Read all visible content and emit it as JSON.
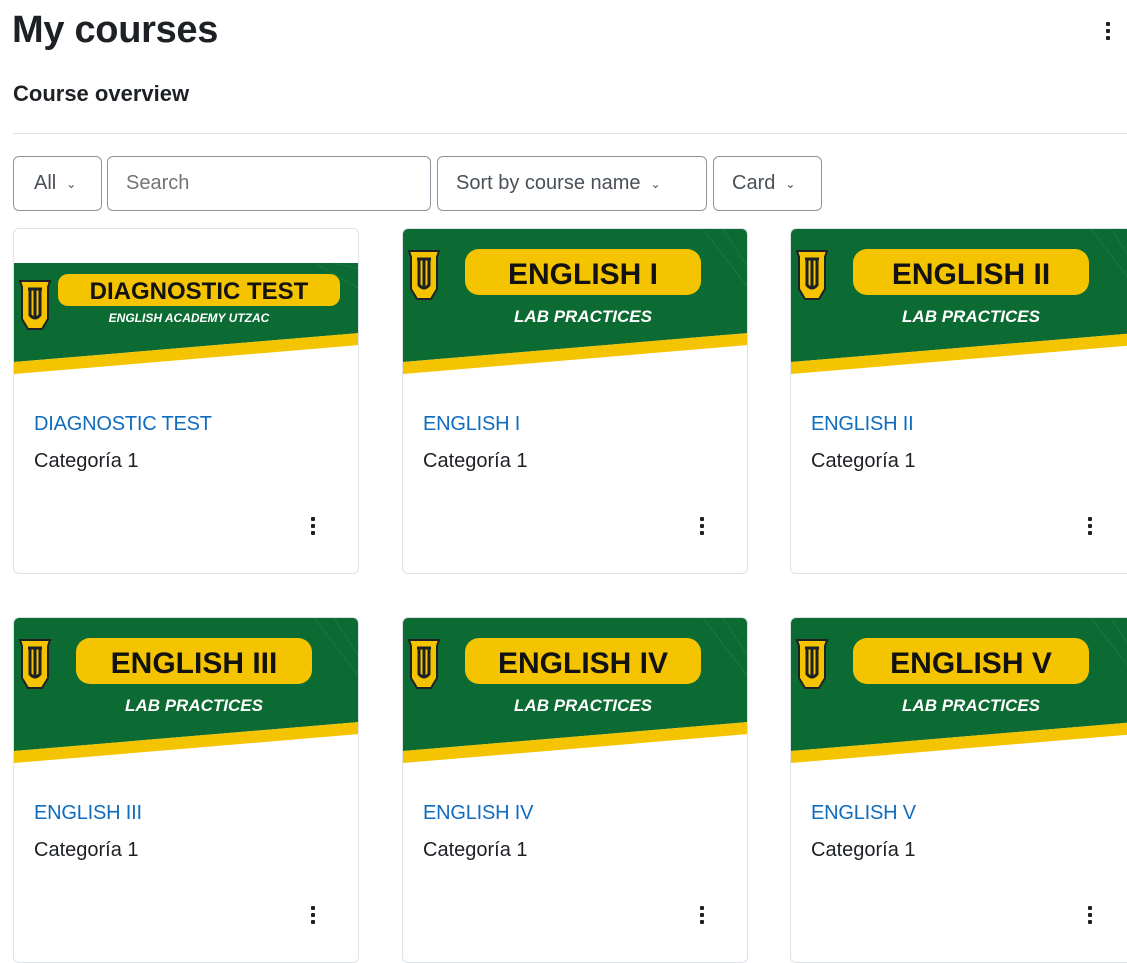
{
  "header": {
    "title": "My courses"
  },
  "section": {
    "title": "Course overview"
  },
  "filters": {
    "grouping": "All",
    "search_placeholder": "Search",
    "sort": "Sort by course name",
    "view": "Card"
  },
  "colors": {
    "banner_green": "#0b6b33",
    "banner_yellow": "#f5c400",
    "link_blue": "#0f6cbf"
  },
  "courses": [
    {
      "name": "DIAGNOSTIC TEST",
      "category": "Categoría 1",
      "banner_title": "DIAGNOSTIC TEST",
      "banner_subtitle": "ENGLISH ACADEMY UTZAC"
    },
    {
      "name": "ENGLISH I",
      "category": "Categoría 1",
      "banner_title": "ENGLISH I",
      "banner_subtitle": "LAB PRACTICES"
    },
    {
      "name": "ENGLISH II",
      "category": "Categoría 1",
      "banner_title": "ENGLISH II",
      "banner_subtitle": "LAB PRACTICES"
    },
    {
      "name": "ENGLISH III",
      "category": "Categoría 1",
      "banner_title": "ENGLISH III",
      "banner_subtitle": "LAB PRACTICES"
    },
    {
      "name": "ENGLISH IV",
      "category": "Categoría 1",
      "banner_title": "ENGLISH IV",
      "banner_subtitle": "LAB PRACTICES"
    },
    {
      "name": "ENGLISH V",
      "category": "Categoría 1",
      "banner_title": "ENGLISH V",
      "banner_subtitle": "LAB PRACTICES"
    }
  ]
}
